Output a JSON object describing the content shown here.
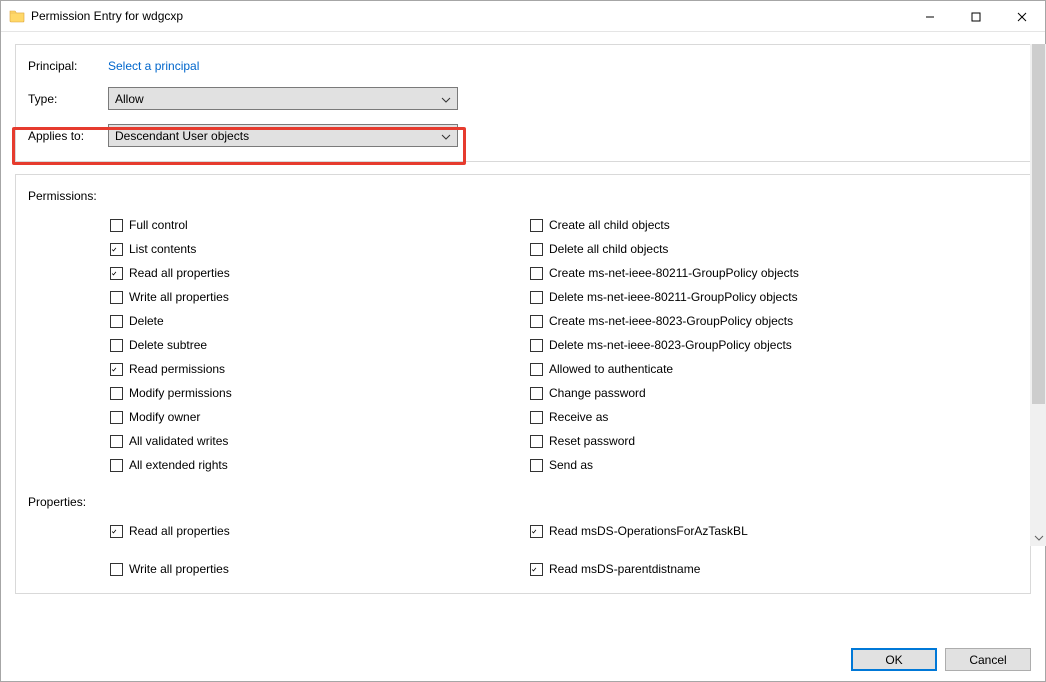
{
  "window": {
    "title": "Permission Entry for wdgcxp",
    "ok": "OK",
    "cancel": "Cancel"
  },
  "form": {
    "principal_label": "Principal:",
    "principal_link": "Select a principal",
    "type_label": "Type:",
    "type_value": "Allow",
    "applies_label": "Applies to:",
    "applies_value": "Descendant User objects"
  },
  "sections": {
    "permissions": "Permissions:",
    "properties": "Properties:"
  },
  "perm_left": [
    {
      "label": "Full control",
      "checked": false
    },
    {
      "label": "List contents",
      "checked": true
    },
    {
      "label": "Read all properties",
      "checked": true
    },
    {
      "label": "Write all properties",
      "checked": false
    },
    {
      "label": "Delete",
      "checked": false
    },
    {
      "label": "Delete subtree",
      "checked": false
    },
    {
      "label": "Read permissions",
      "checked": true
    },
    {
      "label": "Modify permissions",
      "checked": false
    },
    {
      "label": "Modify owner",
      "checked": false
    },
    {
      "label": "All validated writes",
      "checked": false
    },
    {
      "label": "All extended rights",
      "checked": false
    }
  ],
  "perm_right": [
    {
      "label": "Create all child objects",
      "checked": false
    },
    {
      "label": "Delete all child objects",
      "checked": false
    },
    {
      "label": "Create ms-net-ieee-80211-GroupPolicy objects",
      "checked": false
    },
    {
      "label": "Delete ms-net-ieee-80211-GroupPolicy objects",
      "checked": false
    },
    {
      "label": "Create ms-net-ieee-8023-GroupPolicy objects",
      "checked": false
    },
    {
      "label": "Delete ms-net-ieee-8023-GroupPolicy objects",
      "checked": false
    },
    {
      "label": "Allowed to authenticate",
      "checked": false
    },
    {
      "label": "Change password",
      "checked": false
    },
    {
      "label": "Receive as",
      "checked": false
    },
    {
      "label": "Reset password",
      "checked": false
    },
    {
      "label": "Send as",
      "checked": false
    }
  ],
  "prop_left": [
    {
      "label": "Read all properties",
      "checked": true
    },
    {
      "label": "Write all properties",
      "checked": false
    }
  ],
  "prop_right": [
    {
      "label": "Read msDS-OperationsForAzTaskBL",
      "checked": true
    },
    {
      "label": "Read msDS-parentdistname",
      "checked": true
    }
  ]
}
